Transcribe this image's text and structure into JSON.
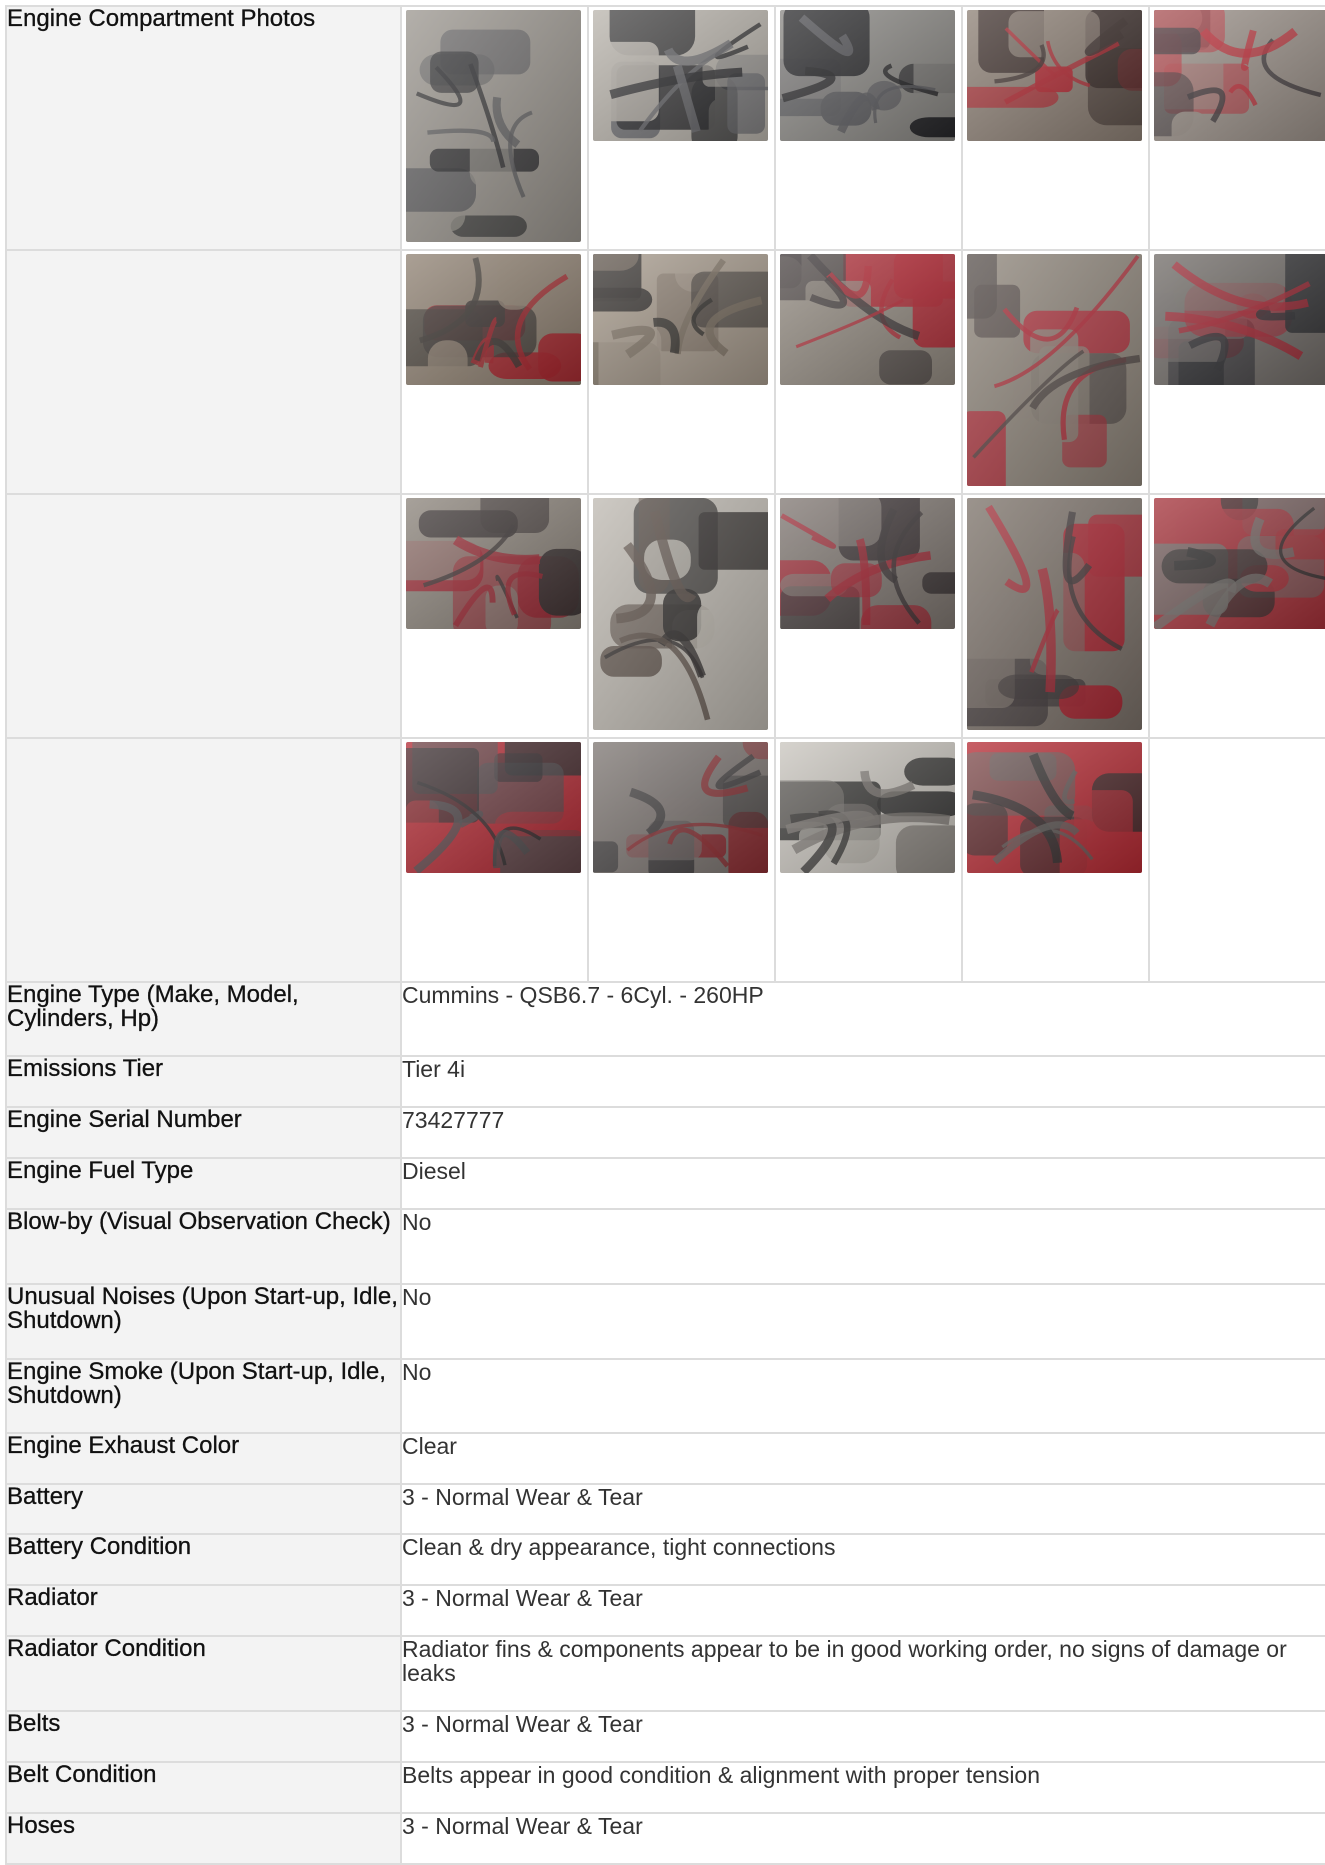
{
  "photos_label": "Engine Compartment Photos",
  "photo_rows": [
    [
      {
        "name": "engine-photo-1",
        "tall": true,
        "palette": [
          "#5b5b5e",
          "#2c2c2e",
          "#9a958e"
        ]
      },
      {
        "name": "engine-photo-2",
        "tall": false,
        "palette": [
          "#6f6f73",
          "#2a2a2d",
          "#b9b4ac"
        ]
      },
      {
        "name": "engine-photo-3",
        "tall": false,
        "palette": [
          "#59595c",
          "#1e1e21",
          "#8a8884"
        ]
      },
      {
        "name": "engine-photo-4",
        "tall": false,
        "palette": [
          "#b2242e",
          "#3a2d2a",
          "#8c7f74"
        ]
      },
      {
        "name": "engine-photo-5",
        "tall": false,
        "palette": [
          "#c02a36",
          "#3b3538",
          "#9a9088"
        ]
      }
    ],
    [
      {
        "name": "engine-photo-6",
        "tall": false,
        "palette": [
          "#a8222b",
          "#3a3431",
          "#8e8071"
        ]
      },
      {
        "name": "engine-photo-7",
        "tall": false,
        "palette": [
          "#7a6e60",
          "#2d2a28",
          "#a69a8c"
        ]
      },
      {
        "name": "engine-photo-8",
        "tall": false,
        "palette": [
          "#b52733",
          "#3a3334",
          "#928a80"
        ]
      },
      {
        "name": "engine-photo-9",
        "tall": true,
        "palette": [
          "#b32533",
          "#4b4240",
          "#8d8479"
        ]
      },
      {
        "name": "engine-photo-10",
        "tall": false,
        "palette": [
          "#a5212e",
          "#2c2c30",
          "#6f6a66"
        ]
      }
    ],
    [
      {
        "name": "engine-photo-11",
        "tall": false,
        "palette": [
          "#9e2330",
          "#3a3333",
          "#8a8279"
        ]
      },
      {
        "name": "engine-photo-12",
        "tall": true,
        "palette": [
          "#5a4e46",
          "#2e2b2a",
          "#bdb8b0"
        ]
      },
      {
        "name": "engine-photo-13",
        "tall": false,
        "palette": [
          "#a42230",
          "#3a3334",
          "#7e7670"
        ]
      },
      {
        "name": "engine-photo-14",
        "tall": true,
        "palette": [
          "#a9222f",
          "#3a3334",
          "#7a7068"
        ]
      },
      {
        "name": "engine-photo-15",
        "tall": false,
        "palette": [
          "#6e6a66",
          "#2c2a2a",
          "#a33038"
        ]
      }
    ],
    [
      {
        "name": "engine-photo-16",
        "tall": false,
        "palette": [
          "#4c4b4d",
          "#2a292b",
          "#b22a34"
        ]
      },
      {
        "name": "engine-photo-17",
        "tall": false,
        "palette": [
          "#8d2a30",
          "#3c3a3b",
          "#7b7470"
        ]
      },
      {
        "name": "engine-photo-18",
        "tall": false,
        "palette": [
          "#7a7570",
          "#2e2d2c",
          "#c8c4bd"
        ]
      },
      {
        "name": "engine-photo-19",
        "tall": false,
        "palette": [
          "#5e5a58",
          "#2b2a2a",
          "#b52a33"
        ]
      },
      null
    ]
  ],
  "rows": [
    {
      "label": "Engine Type (Make, Model, Cylinders, Hp)",
      "value": "Cummins - QSB6.7 - 6Cyl. - 260HP",
      "height": 74
    },
    {
      "label": "Emissions Tier",
      "value": "Tier 4i",
      "height": 51
    },
    {
      "label": "Engine Serial Number",
      "value": "73427777",
      "height": 51
    },
    {
      "label": "Engine Fuel Type",
      "value": "Diesel",
      "height": 51
    },
    {
      "label": "Blow-by (Visual Observation Check)",
      "value": "No",
      "height": 75
    },
    {
      "label": "Unusual Noises (Upon Start-up, Idle, Shutdown)",
      "value": "No",
      "height": 75
    },
    {
      "label": "Engine Smoke (Upon Start-up, Idle, Shutdown)",
      "value": "No",
      "height": 74
    },
    {
      "label": "Engine Exhaust Color",
      "value": "Clear",
      "height": 51
    },
    {
      "label": "Battery",
      "value": "3 - Normal Wear & Tear",
      "height": 50
    },
    {
      "label": "Battery Condition",
      "value": "Clean & dry appearance, tight connections",
      "height": 51
    },
    {
      "label": "Radiator",
      "value": "3 - Normal Wear & Tear",
      "height": 51
    },
    {
      "label": "Radiator Condition",
      "value": "Radiator fins & components appear to be in good working order, no signs of damage or leaks",
      "height": 75
    },
    {
      "label": "Belts",
      "value": "3 - Normal Wear & Tear",
      "height": 51
    },
    {
      "label": "Belt Condition",
      "value": "Belts appear in good condition & alignment with proper tension",
      "height": 51
    },
    {
      "label": "Hoses",
      "value": "3 - Normal Wear & Tear",
      "height": 51
    }
  ]
}
